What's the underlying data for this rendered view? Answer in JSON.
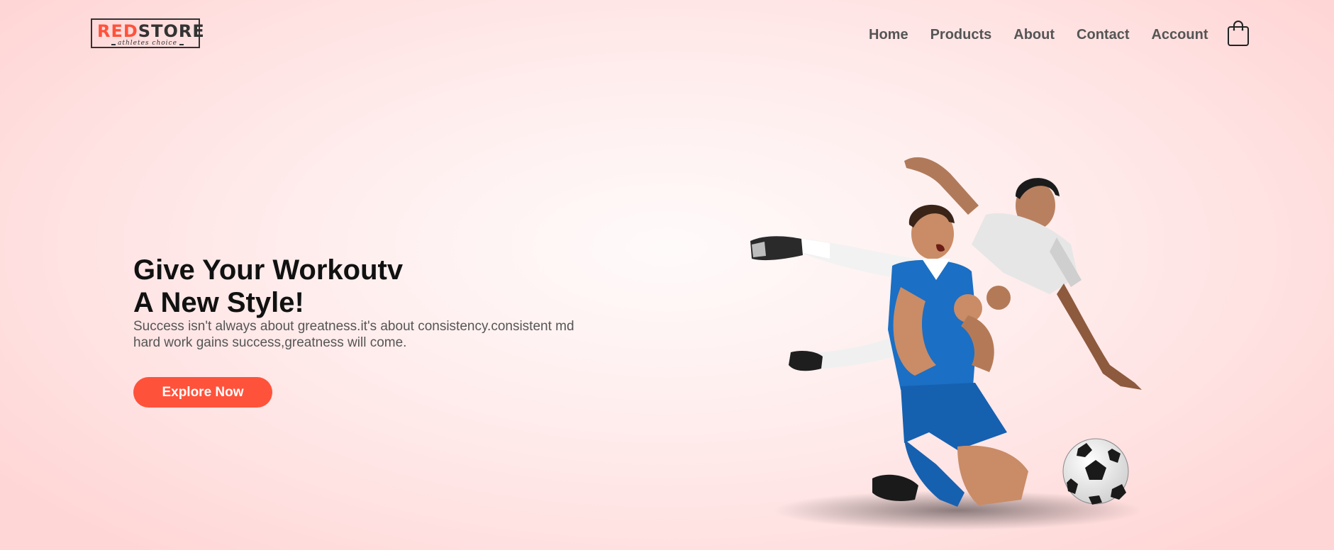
{
  "logo": {
    "red_text": "RED",
    "dark_text": "STORE",
    "tagline": "athletes choice"
  },
  "nav": {
    "items": [
      {
        "label": "Home"
      },
      {
        "label": "Products"
      },
      {
        "label": "About"
      },
      {
        "label": "Contact"
      },
      {
        "label": "Account"
      }
    ],
    "cart_icon": "shopping-bag-icon"
  },
  "hero": {
    "headline_line1": "Give Your Workoutv",
    "headline_line2": "A New Style!",
    "subtext_line1": "Success isn't always about greatness.it's about consistency.consistent md",
    "subtext_line2": "hard work gains success,greatness will come.",
    "button_label": "Explore Now",
    "image": "soccer-players-image"
  },
  "colors": {
    "accent": "#ff523b",
    "nav_text": "#555555",
    "headline": "#111111",
    "background": "#ffe3e3"
  }
}
